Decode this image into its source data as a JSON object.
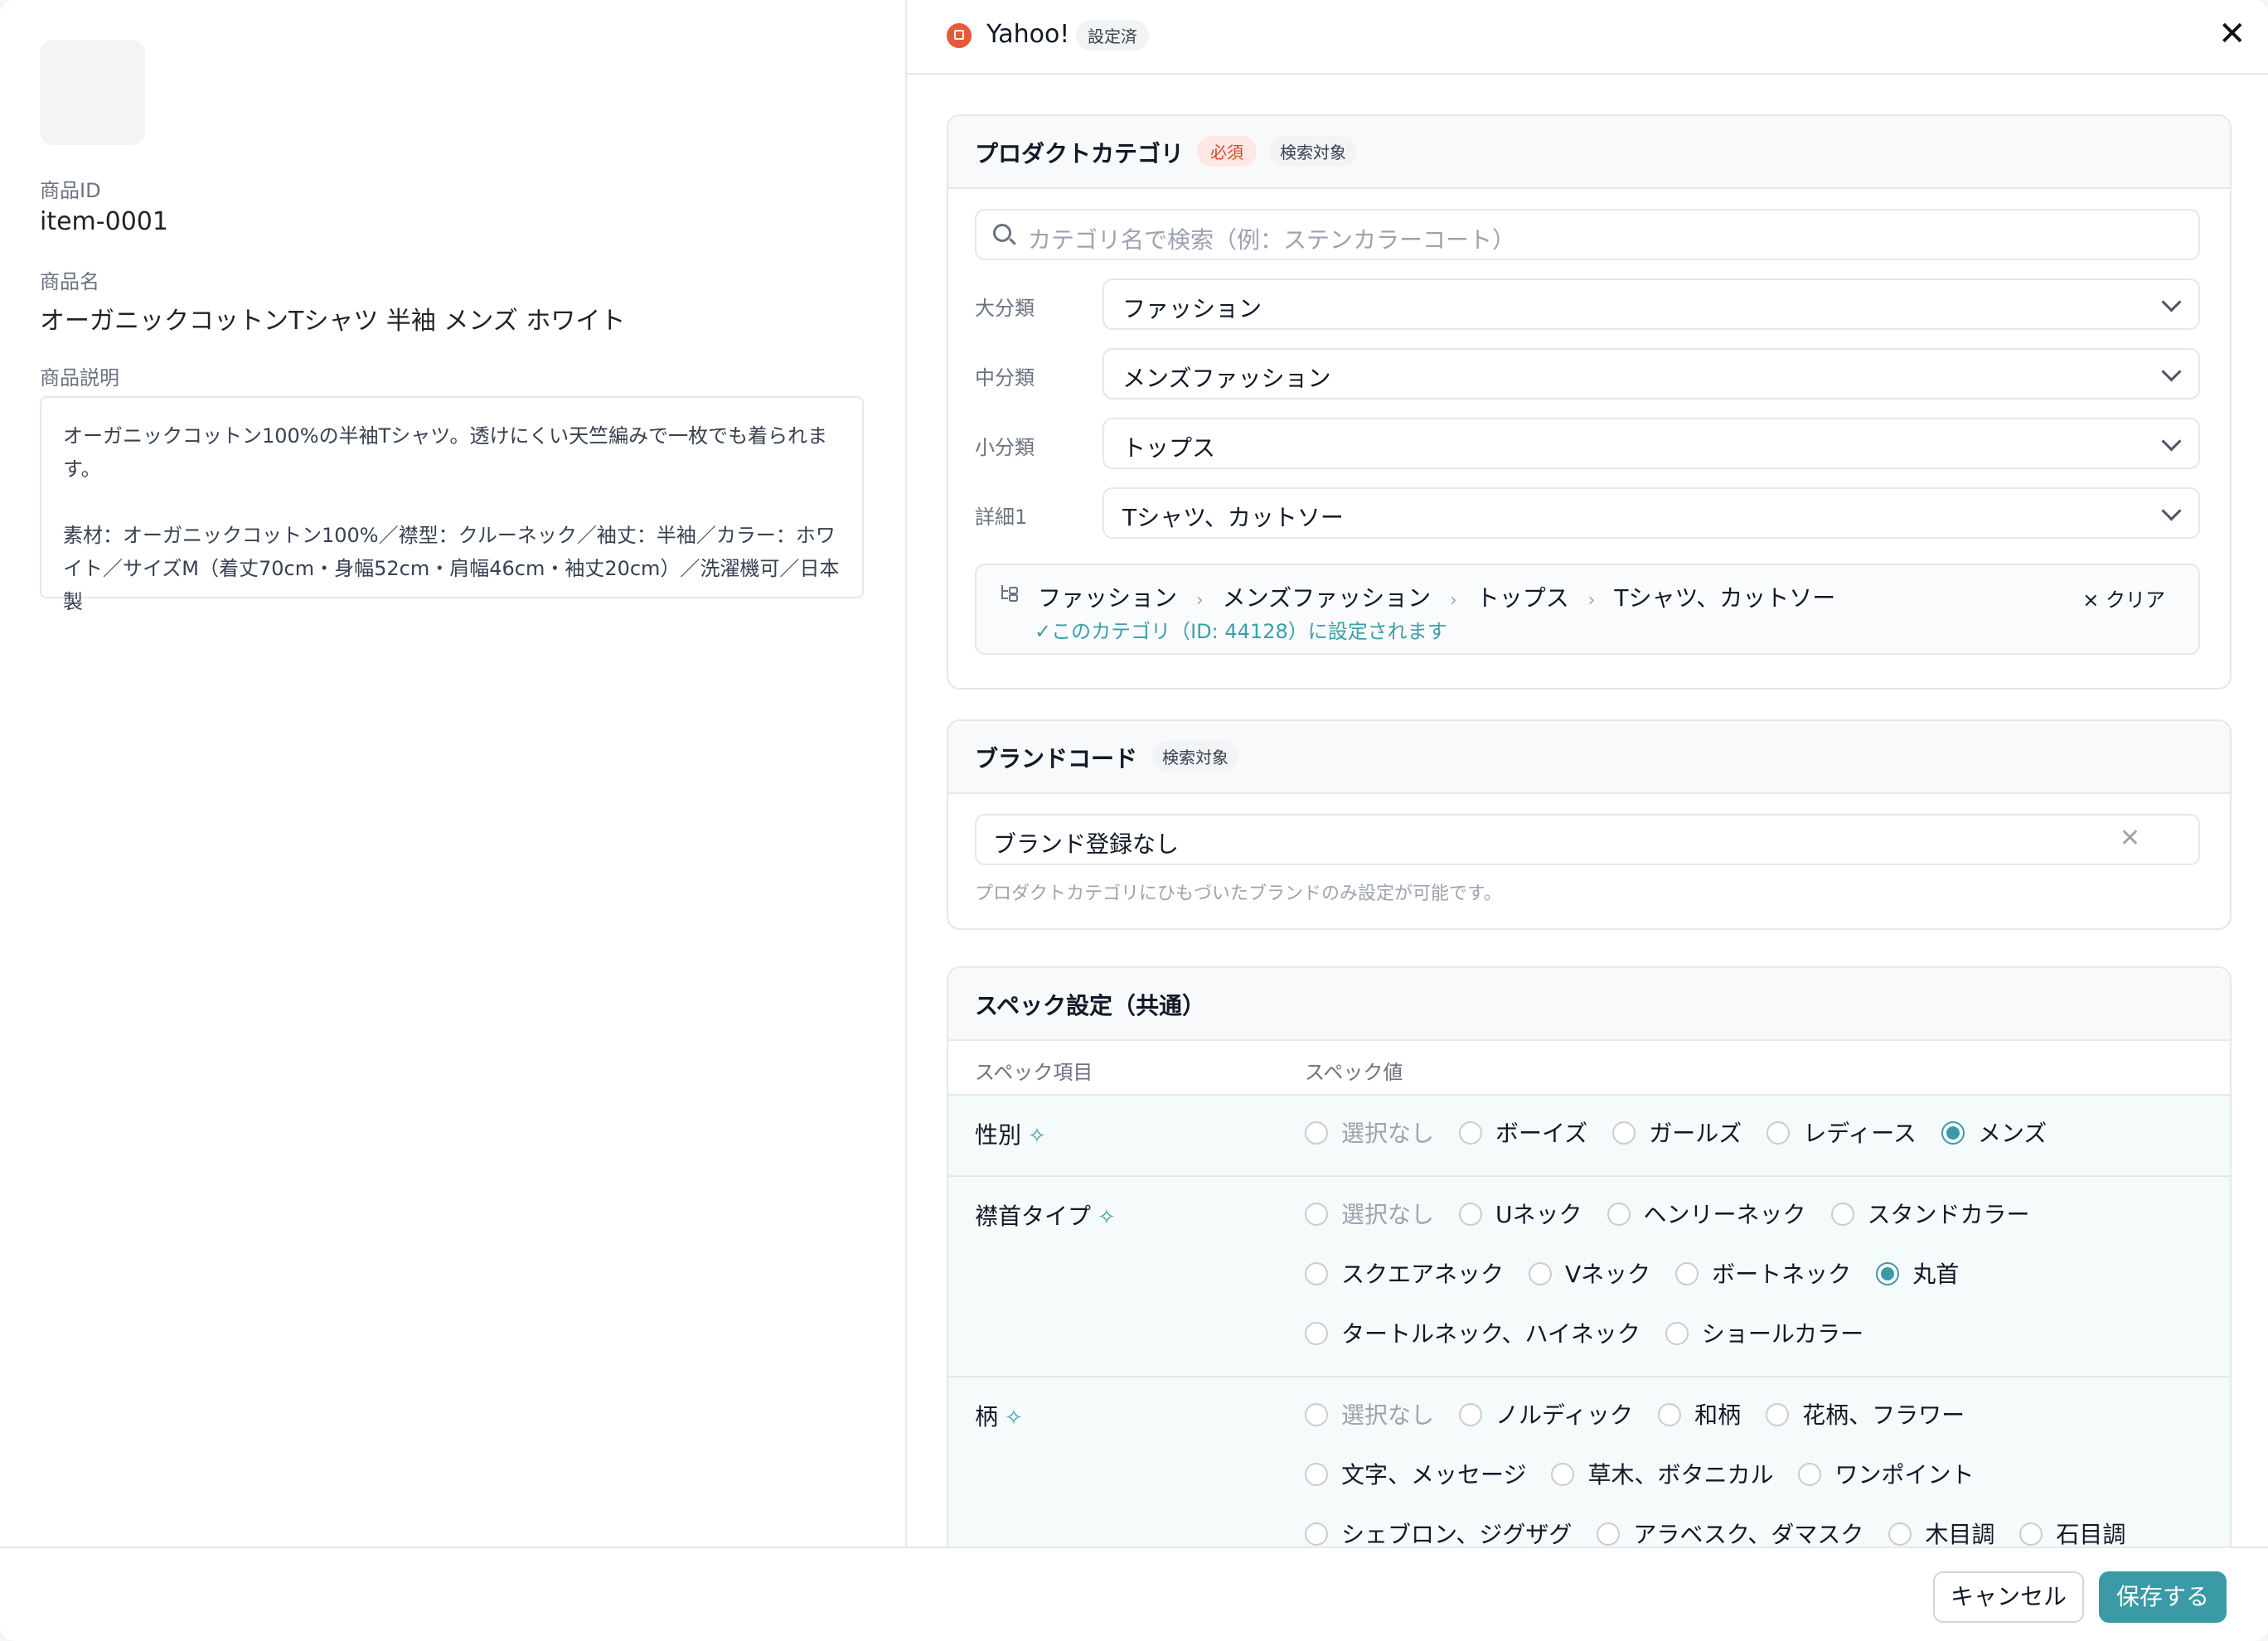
{
  "product": {
    "id_label": "商品ID",
    "id_value": "item-0001",
    "name_label": "商品名",
    "name_value": "オーガニックコットンTシャツ 半袖 メンズ ホワイト",
    "desc_label": "商品説明",
    "desc_p1": "オーガニックコットン100%の半袖Tシャツ。透けにくい天竺編みで一枚でも着られます。",
    "desc_p2": "素材：オーガニックコットン100%／襟型：クルーネック／袖丈：半袖／カラー：ホワイト／サイズM（着丈70cm・身幅52cm・肩幅46cm・袖丈20cm）／洗濯機可／日本製"
  },
  "header": {
    "brand": "Yahoo!",
    "status": "設定済",
    "close": "✕"
  },
  "category": {
    "title": "プロダクトカテゴリ",
    "required": "必須",
    "searchable": "検索対象",
    "search_placeholder": "カテゴリ名で検索（例：ステンカラーコート）",
    "levels": [
      {
        "label": "大分類",
        "value": "ファッション"
      },
      {
        "label": "中分類",
        "value": "メンズファッション"
      },
      {
        "label": "小分類",
        "value": "トップス"
      },
      {
        "label": "詳細1",
        "value": "Tシャツ、カットソー"
      }
    ],
    "path": [
      "ファッション",
      "メンズファッション",
      "トップス",
      "Tシャツ、カットソー"
    ],
    "path_sep": "›",
    "note": "✓このカテゴリ（ID: 44128）に設定されます",
    "clear": "× クリア"
  },
  "brand": {
    "title": "ブランドコード",
    "searchable": "検索対象",
    "value": "ブランド登録なし",
    "hint": "プロダクトカテゴリにひもづいたブランドのみ設定が可能です。"
  },
  "spec": {
    "title": "スペック設定（共通）",
    "col_item": "スペック項目",
    "col_value": "スペック値",
    "rows": [
      {
        "name": "性別",
        "lines": [
          [
            {
              "label": "選択なし",
              "muted": true
            },
            {
              "label": "ボーイズ"
            },
            {
              "label": "ガールズ"
            },
            {
              "label": "レディース"
            },
            {
              "label": "メンズ",
              "selected": true
            }
          ]
        ]
      },
      {
        "name": "襟首タイプ",
        "lines": [
          [
            {
              "label": "選択なし",
              "muted": true
            },
            {
              "label": "Uネック"
            },
            {
              "label": "ヘンリーネック"
            },
            {
              "label": "スタンドカラー"
            }
          ],
          [
            {
              "label": "スクエアネック"
            },
            {
              "label": "Vネック"
            },
            {
              "label": "ボートネック"
            },
            {
              "label": "丸首",
              "selected": true
            }
          ],
          [
            {
              "label": "タートルネック、ハイネック"
            },
            {
              "label": "ショールカラー"
            }
          ]
        ]
      },
      {
        "name": "柄",
        "lines": [
          [
            {
              "label": "選択なし",
              "muted": true
            },
            {
              "label": "ノルディック"
            },
            {
              "label": "和柄"
            },
            {
              "label": "花柄、フラワー"
            }
          ],
          [
            {
              "label": "文字、メッセージ"
            },
            {
              "label": "草木、ボタニカル"
            },
            {
              "label": "ワンポイント"
            }
          ],
          [
            {
              "label": "シェブロン、ジグザグ"
            },
            {
              "label": "アラベスク、ダマスク"
            },
            {
              "label": "木目調"
            },
            {
              "label": "石目調"
            }
          ]
        ]
      }
    ]
  },
  "footer": {
    "cancel": "キャンセル",
    "save": "保存する"
  },
  "colors": {
    "accent": "#3a9aa6",
    "required": "#d9472b",
    "brand_icon": "#e8593a"
  }
}
